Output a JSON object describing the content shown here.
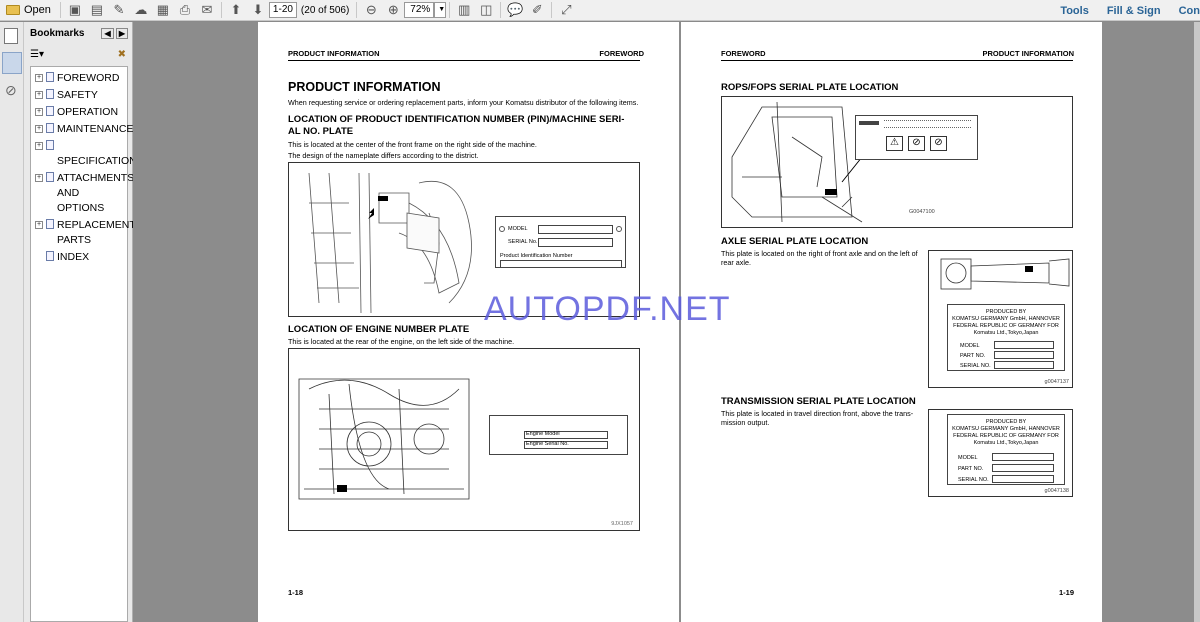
{
  "toolbar": {
    "open_label": "Open",
    "page_value": "1-20",
    "page_count": "(20 of 506)",
    "zoom_value": "72%",
    "tools_label": "Tools",
    "fill_sign_label": "Fill & Sign",
    "comment_label": "Con"
  },
  "bookmarks": {
    "title": "Bookmarks",
    "items": [
      {
        "label": "FOREWORD"
      },
      {
        "label": "SAFETY"
      },
      {
        "label": "OPERATION"
      },
      {
        "label": "MAINTENANCE"
      },
      {
        "label": "SPECIFICATIONS"
      },
      {
        "label": "ATTACHMENTS AND OPTIONS"
      },
      {
        "label": "REPLACEMENT PARTS"
      },
      {
        "label": "INDEX"
      }
    ]
  },
  "left_page": {
    "header_left": "PRODUCT INFORMATION",
    "header_right": "FOREWORD",
    "title": "PRODUCT INFORMATION",
    "intro": "When requesting service or ordering replacement parts, inform your Komatsu distributor of the following items.",
    "section1_title_line1": "LOCATION OF PRODUCT IDENTIFICATION NUMBER (PIN)/MACHINE SERI-",
    "section1_title_line2": "AL NO. PLATE",
    "section1_text1": "This is located at the center of the front frame on the right side of the machine.",
    "section1_text2": "The design of the nameplate differs according to the district.",
    "plate1_model": "MODEL",
    "plate1_serial": "SERIAL No.",
    "plate1_pin": "Product Identification Number",
    "section2_title": "LOCATION OF ENGINE NUMBER PLATE",
    "section2_text": "This is located at the rear of the engine, on the left side of the machine.",
    "engine_model": "Engine Model",
    "engine_serial": "Engine Serial No.",
    "fig2_code": "9JX1057",
    "page_number": "1-18"
  },
  "right_page": {
    "header_left": "FOREWORD",
    "header_right": "PRODUCT INFORMATION",
    "section1_title": "ROPS/FOPS SERIAL PLATE LOCATION",
    "fig1_code": "G0047100",
    "section2_title": "AXLE SERIAL PLATE LOCATION",
    "section2_text": "This plate is located on the right of front axle and on the left of rear axle.",
    "plate_produced_by": "PRODUCED BY",
    "plate_company": "KOMATSU GERMANY GmbH, HANNOVER",
    "plate_country": "FEDERAL REPUBLIC OF GERMANY FOR",
    "plate_komatsu": "Komatsu Ltd.,Tokyo,Japan",
    "plate_model": "MODEL",
    "plate_part": "PART NO.",
    "plate_serial": "SERIAL NO.",
    "fig2_code": "g0047137",
    "section3_title": "TRANSMISSION SERIAL PLATE LOCATION",
    "section3_text": "This plate is located in travel direction front, above the trans-mission output.",
    "fig3_code": "g0047138",
    "page_number": "1-19"
  },
  "watermark": "AUTOPDF.NET"
}
